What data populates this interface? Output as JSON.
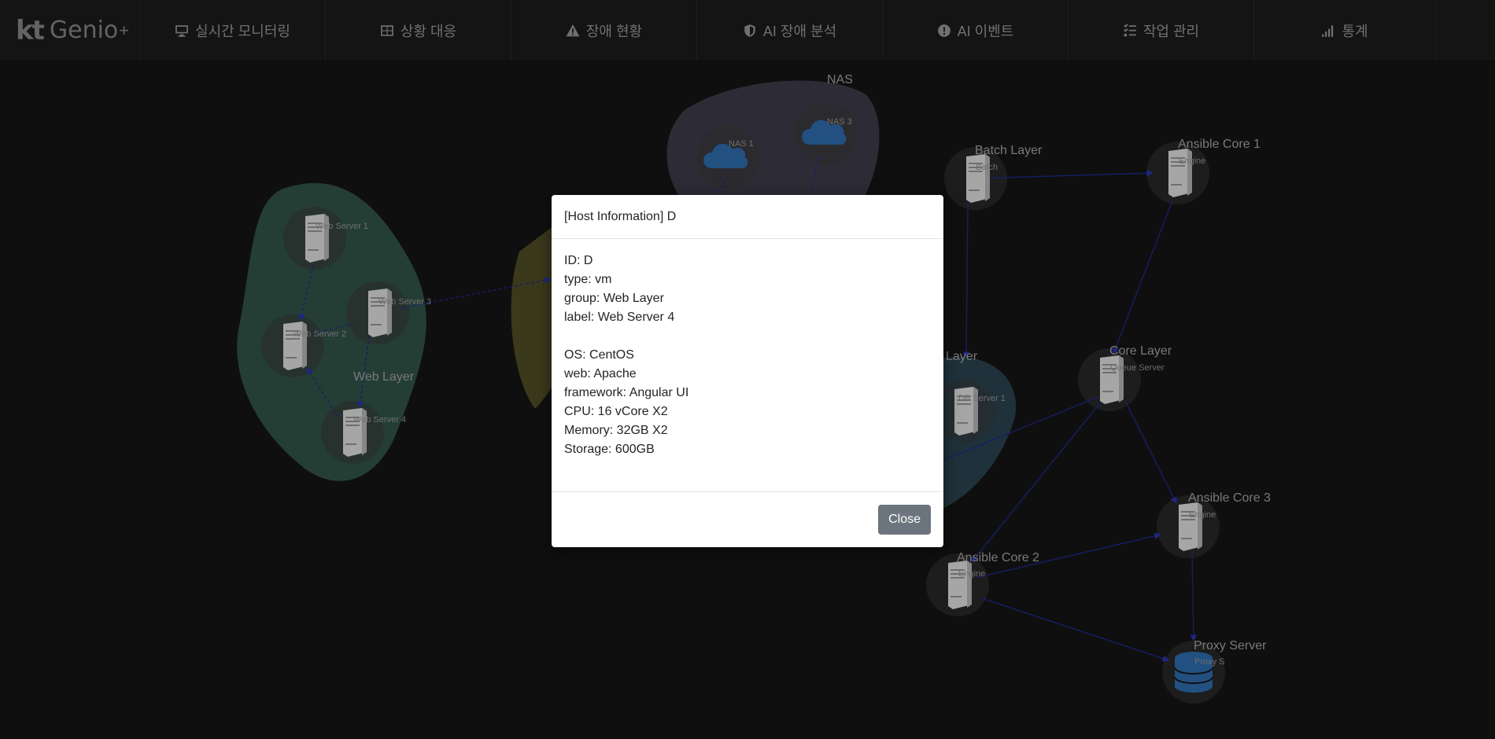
{
  "header": {
    "logo": {
      "brand": "kt",
      "product": "Genio",
      "suffix": "+"
    },
    "nav": [
      {
        "label": "실시간 모니터링",
        "icon": "monitor-icon"
      },
      {
        "label": "상황 대응",
        "icon": "table-icon"
      },
      {
        "label": "장애 현황",
        "icon": "warning-icon"
      },
      {
        "label": "AI 장애 분석",
        "icon": "shield-icon"
      },
      {
        "label": "AI 이벤트",
        "icon": "alert-circle-icon"
      },
      {
        "label": "작업 관리",
        "icon": "task-list-icon"
      },
      {
        "label": "통계",
        "icon": "signal-bars-icon"
      }
    ]
  },
  "graph": {
    "groups": [
      "NAS",
      "Web Layer",
      "Batch Layer",
      "Ansible Core 1",
      "Core Layer",
      "Layer",
      "Ansible Core 3",
      "Ansible Core 2",
      "Proxy Server"
    ],
    "nodes": [
      "Web Server 1",
      "Web Server 2",
      "Web Server 3",
      "Web Server 4",
      "NAS 1",
      "NAS 3",
      "Batch",
      "Engine",
      "Queue Server",
      "DB Server 1",
      "Engine",
      "Engine",
      "Proxy S"
    ]
  },
  "modal": {
    "title": "[Host Information] D",
    "fields": [
      "ID: D",
      "type: vm",
      "group: Web Layer",
      "label: Web Server 4"
    ],
    "specs": [
      "OS: CentOS",
      "web: Apache",
      "framework: Angular UI",
      "CPU: 16 vCore X2",
      "Memory: 32GB X2",
      "Storage: 600GB"
    ],
    "close_label": "Close"
  },
  "colors": {
    "accent_blue": "#2f6fb3",
    "edge": "#1f2b8c",
    "web_group": "#264038",
    "nas_group": "#2e2c3a",
    "web_server": "#e6e6e6"
  }
}
